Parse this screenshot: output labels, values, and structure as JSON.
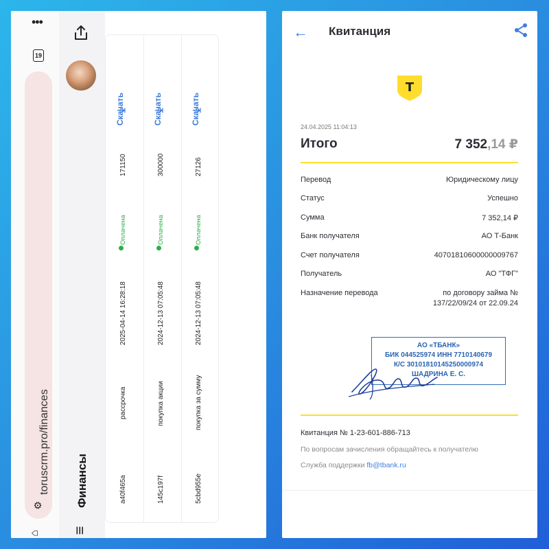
{
  "browser": {
    "url": "toruscrm.pro/finances",
    "tab_count": "19"
  },
  "app": {
    "section_title": "Финансы"
  },
  "table": {
    "download_label": "Скачать",
    "rows": [
      {
        "amount": "171150",
        "status": "Оплачена",
        "date": "2025-04-14 16:28:18",
        "type": "рассрочка",
        "id": "a40f465a"
      },
      {
        "amount": "300000",
        "status": "Оплачена",
        "date": "2024-12-13 07:05:48",
        "type": "покупка акции",
        "id": "145c197f"
      },
      {
        "amount": "27126",
        "status": "Оплачена",
        "date": "2024-12-13 07:05:48",
        "type": "покупка за сумму",
        "id": "5cbd955e"
      }
    ]
  },
  "receipt": {
    "title": "Квитанция",
    "logo_letter": "Т",
    "datetime": "24.04.2025 11:04:13",
    "total_label": "Итого",
    "total_value_main": "7 352",
    "total_value_cents": ",14 ₽",
    "fields": [
      {
        "label": "Перевод",
        "value": "Юридическому лицу"
      },
      {
        "label": "Статус",
        "value": "Успешно"
      },
      {
        "label": "Сумма",
        "value": "7 352,14 ₽"
      },
      {
        "label": "Банк получателя",
        "value": "АО Т-Банк"
      },
      {
        "label": "Счет получателя",
        "value": "40701810600000009767"
      },
      {
        "label": "Получатель",
        "value": "АО \"ТФГ\""
      },
      {
        "label": "Назначение перевода",
        "value": "по договору займа №",
        "value2": "137/22/09/24 от 22.09.24"
      }
    ],
    "stamp_lines": [
      "АО «ТБАНК»",
      "БИК 044525974 ИНН 7710140679",
      "К/С 30101810145250000974",
      "ШАДРИНА Е. С."
    ],
    "receipt_number": "Квитанция  № 1-23-601-886-713",
    "contact_note": "По вопросам зачисления обращайтесь к получателю",
    "support_label": "Служба поддержки ",
    "support_email": "fb@tbank.ru"
  },
  "colors": {
    "accent_blue": "#3c7fe0",
    "bank_yellow": "#ffdd2d",
    "paid_green": "#2eae4e",
    "stamp_blue": "#2a63b1"
  }
}
